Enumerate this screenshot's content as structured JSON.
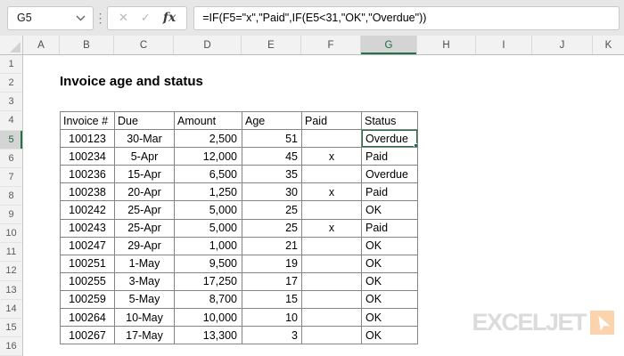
{
  "formula_bar": {
    "name_box_value": "G5",
    "formula": "=IF(F5=\"x\",\"Paid\",IF(E5<31,\"OK\",\"Overdue\"))",
    "icons": {
      "dropdown": "▾",
      "cancel": "✕",
      "enter": "✓",
      "fx": "fx"
    }
  },
  "sheet": {
    "column_headers": [
      "A",
      "B",
      "C",
      "D",
      "E",
      "F",
      "G",
      "H",
      "I",
      "J",
      "K"
    ],
    "selected_column": "G",
    "row_headers": [
      "1",
      "2",
      "3",
      "4",
      "5",
      "6",
      "7",
      "8",
      "9",
      "10",
      "11",
      "12",
      "13",
      "14",
      "15",
      "16"
    ],
    "selected_row": "5",
    "title": "Invoice age and status"
  },
  "table": {
    "headers": [
      "Invoice #",
      "Due",
      "Amount",
      "Age",
      "Paid",
      "Status"
    ],
    "rows": [
      [
        "100123",
        "30-Mar",
        "2,500",
        "51",
        "",
        "Overdue"
      ],
      [
        "100234",
        "5-Apr",
        "12,000",
        "45",
        "x",
        "Paid"
      ],
      [
        "100236",
        "15-Apr",
        "6,500",
        "35",
        "",
        "Overdue"
      ],
      [
        "100238",
        "20-Apr",
        "1,250",
        "30",
        "x",
        "Paid"
      ],
      [
        "100242",
        "25-Apr",
        "5,000",
        "25",
        "",
        "OK"
      ],
      [
        "100243",
        "25-Apr",
        "5,000",
        "25",
        "x",
        "Paid"
      ],
      [
        "100247",
        "29-Apr",
        "1,000",
        "21",
        "",
        "OK"
      ],
      [
        "100251",
        "1-May",
        "9,500",
        "19",
        "",
        "OK"
      ],
      [
        "100255",
        "3-May",
        "17,250",
        "17",
        "",
        "OK"
      ],
      [
        "100259",
        "5-May",
        "8,700",
        "15",
        "",
        "OK"
      ],
      [
        "100264",
        "10-May",
        "10,000",
        "10",
        "",
        "OK"
      ],
      [
        "100267",
        "17-May",
        "13,300",
        "3",
        "",
        "OK"
      ]
    ],
    "selection": {
      "cell_ref": "G5",
      "row_index": 0,
      "col_index": 5,
      "value": "Overdue"
    }
  },
  "logo": {
    "text": "EXCELJET",
    "icon": "paper-plane",
    "square_color": "#FBD3AD",
    "text_color": "#DBDBDB"
  },
  "colors": {
    "excel_green": "#217346",
    "chrome_bg": "#E7E7E7",
    "header_bg": "#F2F2F2",
    "selected_header_bg": "#D4D4D4",
    "table_border": "#848484"
  }
}
